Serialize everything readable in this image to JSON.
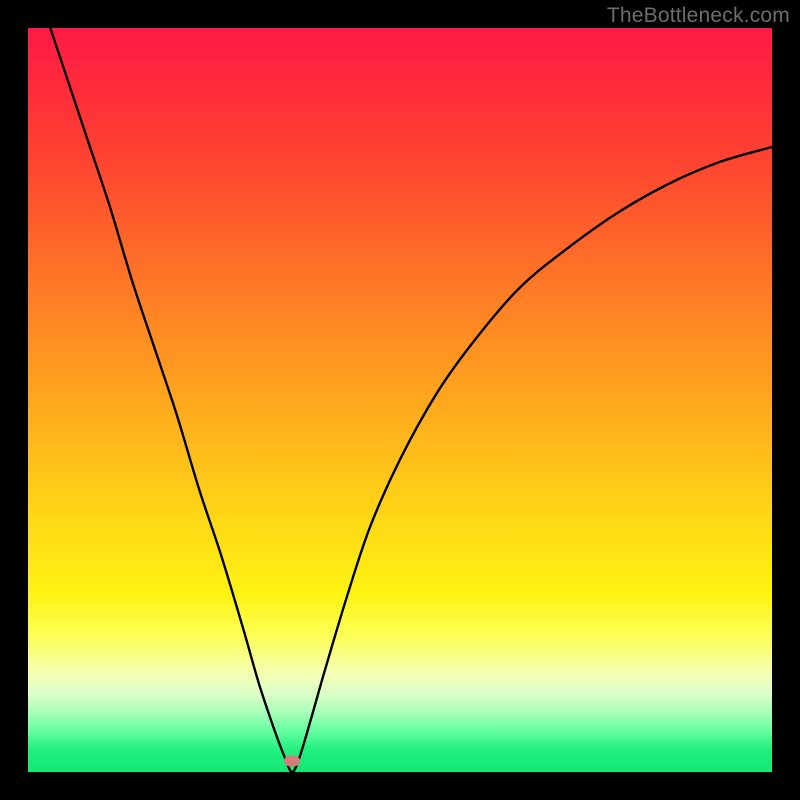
{
  "watermark": "TheBottleneck.com",
  "marker": {
    "x_frac": 0.355,
    "y_frac": 0.985,
    "color": "#d47e7a"
  },
  "chart_data": {
    "type": "line",
    "title": "",
    "xlabel": "",
    "ylabel": "",
    "xlim": [
      0,
      1
    ],
    "ylim": [
      0,
      1
    ],
    "legend": false,
    "grid": false,
    "annotation": "Background gradient: green (low bottleneck) at y≈0 through yellow/orange to red (high bottleneck) at y≈1. A small salmon pill marks the minimum.",
    "series": [
      {
        "name": "bottleneck-curve",
        "x": [
          0.03,
          0.05,
          0.08,
          0.11,
          0.14,
          0.17,
          0.2,
          0.23,
          0.26,
          0.29,
          0.31,
          0.33,
          0.345,
          0.355,
          0.365,
          0.38,
          0.4,
          0.43,
          0.46,
          0.5,
          0.55,
          0.6,
          0.66,
          0.72,
          0.79,
          0.86,
          0.93,
          1.0
        ],
        "y": [
          1.0,
          0.94,
          0.85,
          0.76,
          0.66,
          0.57,
          0.48,
          0.38,
          0.29,
          0.19,
          0.12,
          0.06,
          0.02,
          0.0,
          0.02,
          0.07,
          0.14,
          0.24,
          0.33,
          0.42,
          0.51,
          0.58,
          0.65,
          0.7,
          0.75,
          0.79,
          0.82,
          0.84
        ]
      }
    ]
  }
}
